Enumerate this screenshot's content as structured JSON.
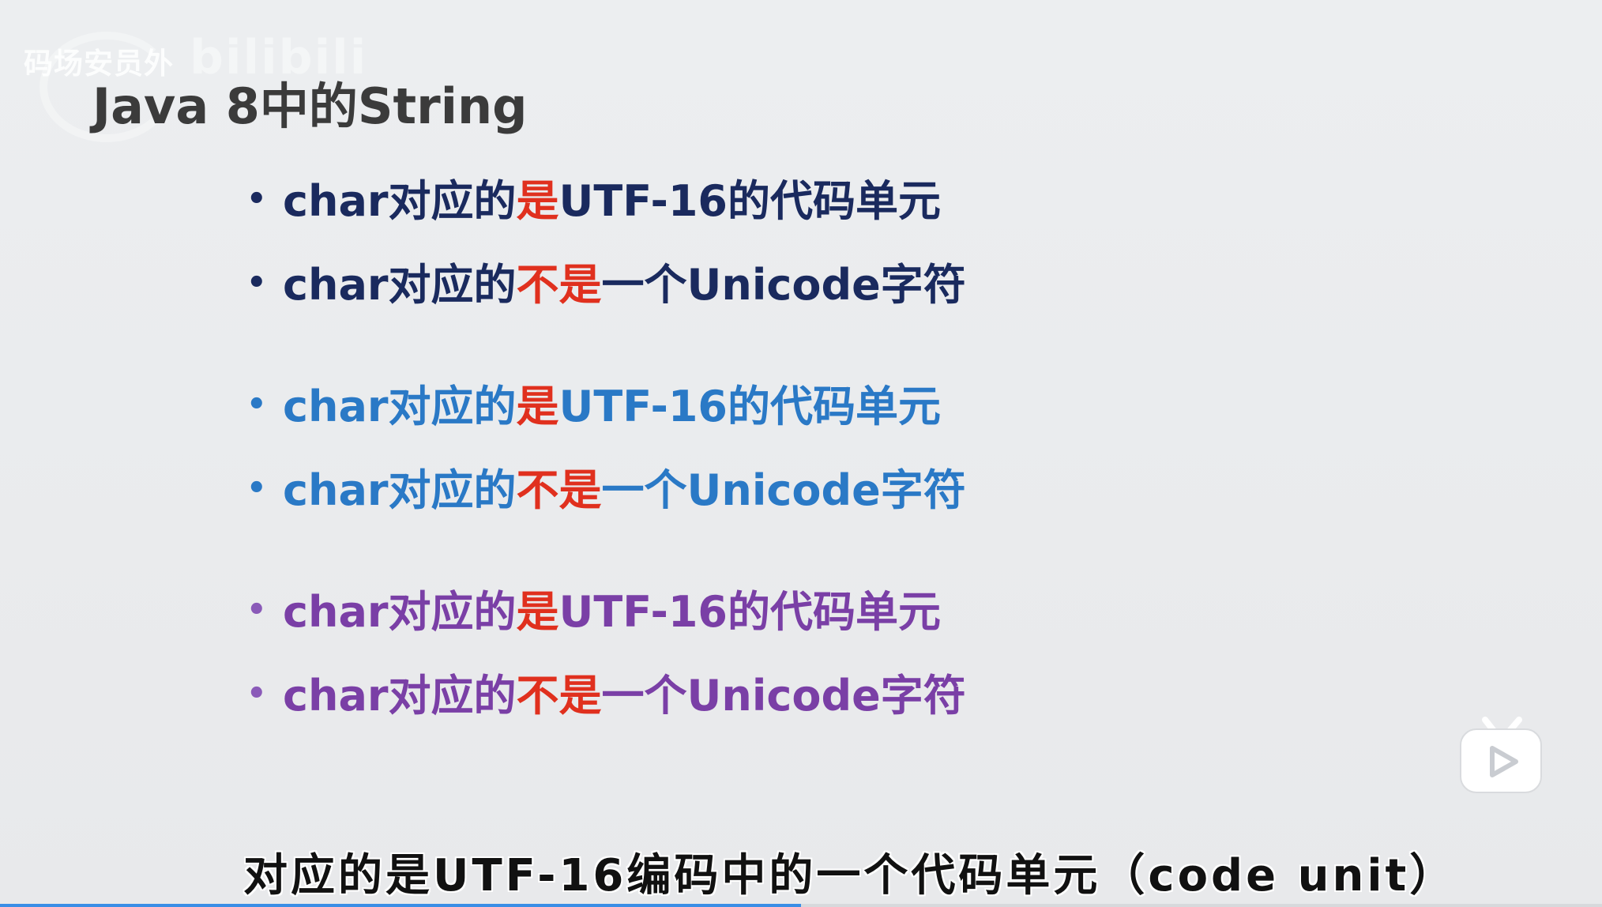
{
  "watermark": {
    "channel": "码场安员外",
    "site_ghost": "bilibili"
  },
  "slide": {
    "title": "Java 8中的String",
    "bullet_groups": [
      {
        "color": "#1a2a5e",
        "items": [
          {
            "pre": "char对应的",
            "red": "是",
            "post": "UTF-16的代码单元"
          },
          {
            "pre": "char对应的",
            "red": "不是",
            "post": "一个Unicode字符"
          }
        ]
      },
      {
        "color": "#2a79c6",
        "items": [
          {
            "pre": "char对应的",
            "red": "是",
            "post": "UTF-16的代码单元"
          },
          {
            "pre": "char对应的",
            "red": "不是",
            "post": "一个Unicode字符"
          }
        ]
      },
      {
        "color": "#7a3fa6",
        "items": [
          {
            "pre": "char对应的",
            "red": "是",
            "post": "UTF-16的代码单元"
          },
          {
            "pre": "char对应的",
            "red": "不是",
            "post": "一个Unicode字符"
          }
        ]
      }
    ],
    "bullet_glyph": "•",
    "highlight_color": "#e0301e"
  },
  "subtitle": {
    "text": "对应的是UTF-16编码中的一个代码单元（code unit）"
  },
  "player": {
    "progress_fraction": 0.5,
    "progress_color": "#3a8ee6",
    "logo_icon": "bilibili-tv-icon"
  }
}
